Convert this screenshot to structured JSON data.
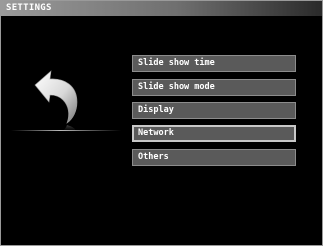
{
  "header": {
    "title": "SETTINGS"
  },
  "back": {
    "icon": "back-arrow-icon"
  },
  "menu": {
    "items": [
      {
        "label": "Slide show time"
      },
      {
        "label": "Slide show mode"
      },
      {
        "label": "Display"
      },
      {
        "label": "Network"
      },
      {
        "label": "Others"
      }
    ],
    "selected_index": 3
  },
  "colors": {
    "background": "#000000",
    "item_fill": "#5a5a5a",
    "item_border": "#8c8c8c",
    "selected_border": "#c8c8c8",
    "text": "#ffffff"
  }
}
